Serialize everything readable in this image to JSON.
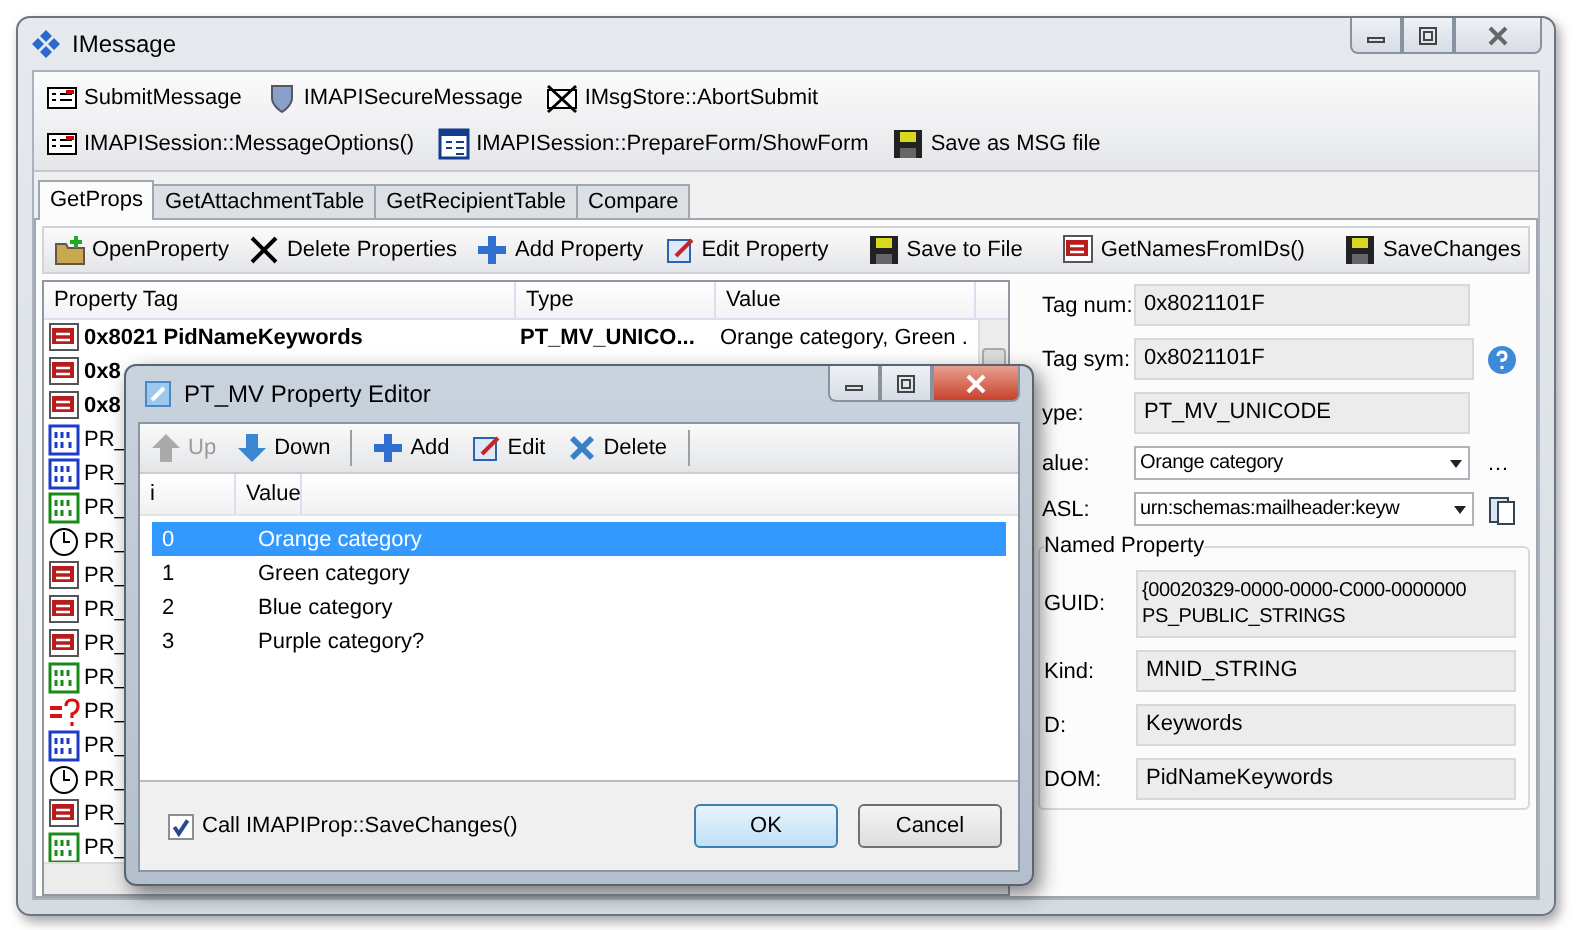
{
  "window": {
    "title": "IMessage"
  },
  "toolbar_rows": [
    [
      {
        "label": "SubmitMessage"
      },
      {
        "label": "IMAPISecureMessage"
      },
      {
        "label": "IMsgStore::AbortSubmit"
      }
    ],
    [
      {
        "label": "IMAPISession::MessageOptions()"
      },
      {
        "label": "IMAPISession::PrepareForm/ShowForm"
      },
      {
        "label": "Save as MSG file"
      }
    ]
  ],
  "tabs": [
    {
      "label": "GetProps",
      "selected": true
    },
    {
      "label": "GetAttachmentTable",
      "selected": false
    },
    {
      "label": "GetRecipientTable",
      "selected": false
    },
    {
      "label": "Compare",
      "selected": false
    }
  ],
  "props_toolbar": [
    {
      "label": "OpenProperty"
    },
    {
      "label": "Delete Properties"
    },
    {
      "label": "Add Property"
    },
    {
      "label": "Edit Property"
    },
    {
      "label": "Save to File"
    },
    {
      "label": "GetNamesFromIDs()"
    },
    {
      "label": "SaveChanges"
    }
  ],
  "table": {
    "columns": [
      "Property Tag",
      "Type",
      "Value"
    ],
    "rows": [
      {
        "kind": "ab",
        "named": true,
        "tag": "0x8021  PidNameKeywords",
        "type": "PT_MV_UNICO...",
        "value": "Orange category, Green ."
      },
      {
        "kind": "ab",
        "named": true,
        "tag": "0x8"
      },
      {
        "kind": "ab",
        "named": true,
        "tag": "0x8"
      },
      {
        "kind": "bin",
        "named": false,
        "tag": "PR_"
      },
      {
        "kind": "bin",
        "named": false,
        "tag": "PR_"
      },
      {
        "kind": "bin-green",
        "named": false,
        "tag": "PR_"
      },
      {
        "kind": "time",
        "named": false,
        "tag": "PR_"
      },
      {
        "kind": "ab",
        "named": false,
        "tag": "PR_"
      },
      {
        "kind": "ab",
        "named": false,
        "tag": "PR_"
      },
      {
        "kind": "ab",
        "named": false,
        "tag": "PR_"
      },
      {
        "kind": "bin-green",
        "named": false,
        "tag": "PR_"
      },
      {
        "kind": "error",
        "named": false,
        "tag": "PR_"
      },
      {
        "kind": "bin",
        "named": false,
        "tag": "PR_"
      },
      {
        "kind": "time",
        "named": false,
        "tag": "PR_"
      },
      {
        "kind": "ab",
        "named": false,
        "tag": "PR_"
      },
      {
        "kind": "bin-green",
        "named": false,
        "tag": "PR_"
      }
    ]
  },
  "details": {
    "fields": [
      {
        "label": "Tag num:",
        "value": "0x8021101F",
        "kind": "text"
      },
      {
        "label": "Tag sym:",
        "value": "0x8021101F",
        "kind": "help"
      },
      {
        "label": "ype:",
        "value": "PT_MV_UNICODE",
        "kind": "text"
      },
      {
        "label": "alue:",
        "value": "Orange category",
        "kind": "dropdown-more",
        "more": "…"
      },
      {
        "label": "ASL:",
        "value": "urn:schemas:mailheader:keyw",
        "kind": "dropdown-copy"
      }
    ],
    "named_property": {
      "title": "Named Property",
      "fields": [
        {
          "label": "GUID:",
          "value": "{00020329-0000-0000-C000-0000000",
          "value2": "PS_PUBLIC_STRINGS"
        },
        {
          "label": "Kind:",
          "value": "MNID_STRING"
        },
        {
          "label": "D:",
          "value": "Keywords"
        },
        {
          "label": "DOM:",
          "value": "PidNameKeywords"
        }
      ]
    }
  },
  "dialog": {
    "title": "PT_MV Property Editor",
    "toolbar": [
      {
        "label": "Up",
        "disabled": true
      },
      {
        "label": "Down",
        "disabled": false
      },
      {
        "label": "Add",
        "disabled": false
      },
      {
        "label": "Edit",
        "disabled": false
      },
      {
        "label": "Delete",
        "disabled": false
      }
    ],
    "columns": [
      "i",
      "Value"
    ],
    "rows": [
      {
        "i": "0",
        "value": "Orange category",
        "selected": true
      },
      {
        "i": "1",
        "value": "Green category",
        "selected": false
      },
      {
        "i": "2",
        "value": "Blue category",
        "selected": false
      },
      {
        "i": "3",
        "value": "Purple category?",
        "selected": false
      }
    ],
    "checkbox": {
      "label": "Call IMAPIProp::SaveChanges()",
      "checked": true
    },
    "buttons": [
      {
        "label": "OK",
        "default": true
      },
      {
        "label": "Cancel",
        "default": false
      }
    ]
  }
}
